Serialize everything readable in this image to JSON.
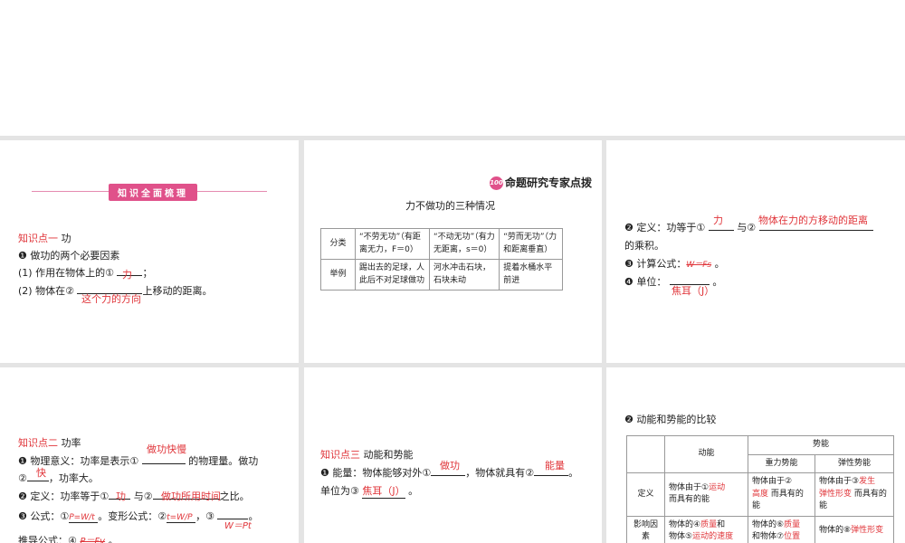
{
  "s1": {
    "banner": "知识全面梳理",
    "kp": "知识点一",
    "kp_title": "功",
    "h1": "❶ 做功的两个必要因素",
    "l1a": "(1) 作用在物体上的①",
    "l1_ans": "力",
    "l1b": "；",
    "l2a": "(2) 物体在②",
    "l2_ans": "这个力的方向",
    "l2b": "上移动的距离。"
  },
  "s2": {
    "brand": "命题研究专家点拨",
    "brand_logo": "100",
    "title": "力不做功的三种情况",
    "rows": [
      [
        "分类",
        "“不劳无功”（有距离无力，F＝0）",
        "“不动无功”（有力无距离，s＝0）",
        "“劳而无功”（力和距离垂直）"
      ],
      [
        "举例",
        "踢出去的足球，人此后不对足球做功",
        "河水冲击石块，石块未动",
        "提着水桶水平前进"
      ]
    ]
  },
  "s3": {
    "d1": "❷ 定义：功等于①",
    "d1_ans": "力",
    "d2": "与②",
    "d2_ans": "物体在力的方移动的距离",
    "d3": "的乘积。",
    "f": "❸ 计算公式：",
    "f_ans": "W＝Fs",
    "f_end": "。",
    "u": "❹ 单位：",
    "u_ans": "焦耳（J）",
    "u_end": "。"
  },
  "s4": {
    "kp": "知识点二",
    "kp_title": "功率",
    "m1": "❶ 物理意义：功率是表示①",
    "m1_ans": "做功快慢",
    "m2": "的物理量。做功",
    "m3": "②",
    "m3_ans": "快",
    "m4": "，功率大。",
    "d1": "❷ 定义：功率等于①",
    "d1_ans": "功",
    "d2": "与②",
    "d2_ans": "做功所用时间",
    "d3": "之比。",
    "f1": "❸ 公式：①",
    "f1_ans": "P=W/t",
    "f2": "。变形公式：②",
    "f2_ans": "t=W/P",
    "f3": "，③",
    "f3_ans": "W＝Pt",
    "f4": "。",
    "g1": "推导公式：④",
    "g1_ans": "P＝Fv",
    "g2": "。"
  },
  "s5": {
    "kp": "知识点三",
    "kp_title": "动能和势能",
    "e1": "❶ 能量：物体能够对外①",
    "e1_ans": "做功",
    "e2": "，物体就具有②",
    "e2_ans": "能量",
    "e3": "。",
    "e4": "单位为③",
    "e4_ans": "焦耳（J）",
    "e5": "。"
  },
  "s6": {
    "title": "❷ 动能和势能的比较",
    "h_kinetic": "动能",
    "h_potential": "势能",
    "h_gravity": "重力势能",
    "h_elastic": "弹性势能",
    "r1": "定义",
    "r1c1a": "物体由于①",
    "r1c1_ans": "运动",
    "r1c1b": "而具有的能",
    "r1c2a": "物体由于②",
    "r1c2_ans": "高度",
    "r1c2b": "而具有的能",
    "r1c3a": "物体由于③",
    "r1c3_ans1": "发生",
    "r1c3_ans2": "弹性形变",
    "r1c3b": "而具有的能",
    "r2": "影响因素",
    "r2c1a": "物体的④",
    "r2c1_ans1": "质量",
    "r2c1b": "和",
    "r2c1c": "物体⑤",
    "r2c1_ans2": "运动的速度",
    "r2c2a": "物体的⑥",
    "r2c2_ans1": "质量",
    "r2c2b": "和物体⑦",
    "r2c2_ans2": "位置",
    "r2c3a": "物体的⑧",
    "r2c3_ans": "弹性形变"
  }
}
